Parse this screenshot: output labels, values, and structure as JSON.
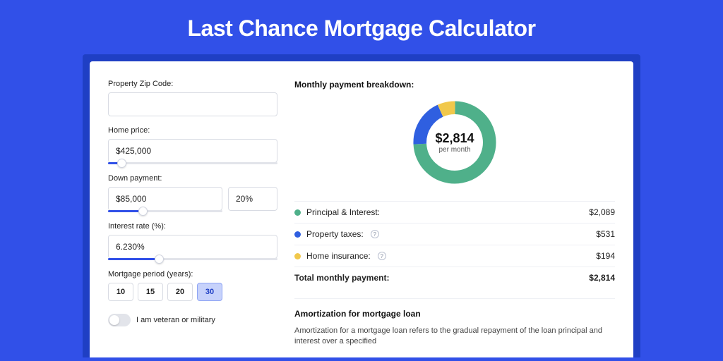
{
  "title": "Last Chance Mortgage Calculator",
  "form": {
    "zip_label": "Property Zip Code:",
    "zip_value": "",
    "price_label": "Home price:",
    "price_value": "$425,000",
    "price_slider_pct": 8,
    "down_label": "Down payment:",
    "down_value": "$85,000",
    "down_pct_value": "20%",
    "down_slider_pct": 20,
    "rate_label": "Interest rate (%):",
    "rate_value": "6.230%",
    "rate_slider_pct": 30,
    "period_label": "Mortgage period (years):",
    "periods": [
      "10",
      "15",
      "20",
      "30"
    ],
    "period_active": "30",
    "veteran_label": "I am veteran or military"
  },
  "breakdown": {
    "heading": "Monthly payment breakdown:",
    "center_value": "$2,814",
    "center_sub": "per month",
    "rows": [
      {
        "label": "Principal & Interest:",
        "value": "$2,089",
        "color": "#4fb08a",
        "info": false
      },
      {
        "label": "Property taxes:",
        "value": "$531",
        "color": "#2f5fe0",
        "info": true
      },
      {
        "label": "Home insurance:",
        "value": "$194",
        "color": "#f1c84b",
        "info": true
      }
    ],
    "total_label": "Total monthly payment:",
    "total_value": "$2,814"
  },
  "amort": {
    "heading": "Amortization for mortgage loan",
    "text": "Amortization for a mortgage loan refers to the gradual repayment of the loan principal and interest over a specified"
  },
  "chart_data": {
    "type": "pie",
    "title": "Monthly payment breakdown",
    "total": 2814,
    "unit": "USD/month",
    "series": [
      {
        "name": "Principal & Interest",
        "value": 2089,
        "color": "#4fb08a"
      },
      {
        "name": "Property taxes",
        "value": 531,
        "color": "#2f5fe0"
      },
      {
        "name": "Home insurance",
        "value": 194,
        "color": "#f1c84b"
      }
    ]
  }
}
